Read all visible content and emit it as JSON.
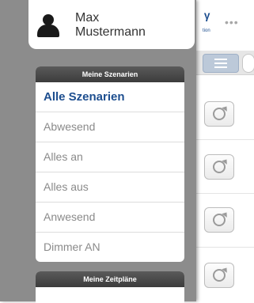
{
  "profile": {
    "first_name": "Max",
    "last_name": "Mustermann",
    "icon": "person-icon"
  },
  "scenarios": {
    "header": "Meine Szenarien",
    "items": [
      {
        "label": "Alle Szenarien",
        "active": true
      },
      {
        "label": "Abwesend",
        "active": false
      },
      {
        "label": "Alles an",
        "active": false
      },
      {
        "label": "Alles aus",
        "active": false
      },
      {
        "label": "Anwesend",
        "active": false
      },
      {
        "label": "Dimmer AN",
        "active": false
      }
    ]
  },
  "schedules": {
    "header": "Meine Zeitpläne"
  },
  "background": {
    "logo_caption": "tion",
    "more_icon": "more-dots-icon",
    "list_icon": "list-icon",
    "row_icon": "refresh-icon"
  },
  "colors": {
    "drawer_bg": "#8c8c8c",
    "accent": "#1d4e8f",
    "section_header": "#474747"
  }
}
